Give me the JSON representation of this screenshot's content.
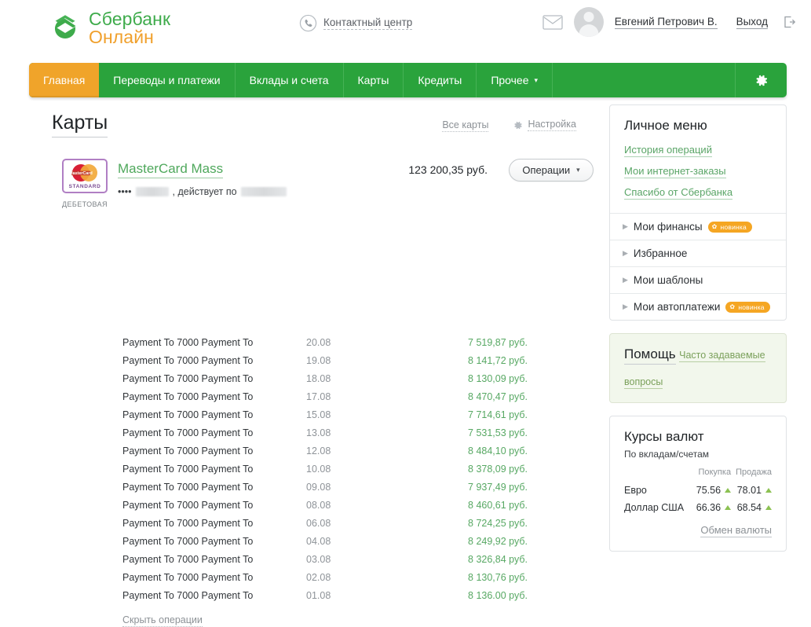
{
  "header": {
    "logo_line1": "Сбербанк",
    "logo_line2": "Онлайн",
    "contact_center": "Контактный центр",
    "user_name": "Евгений Петрович В.",
    "logout": "Выход"
  },
  "nav": {
    "items": [
      {
        "label": "Главная",
        "active": true,
        "caret": ""
      },
      {
        "label": "Переводы и платежи",
        "active": false,
        "caret": ""
      },
      {
        "label": "Вклады и счета",
        "active": false,
        "caret": ""
      },
      {
        "label": "Карты",
        "active": false,
        "caret": ""
      },
      {
        "label": "Кредиты",
        "active": false,
        "caret": ""
      },
      {
        "label": "Прочее",
        "active": false,
        "caret": "▾"
      }
    ]
  },
  "page": {
    "title": "Карты",
    "all_cards": "Все карты",
    "settings": "Настройка"
  },
  "card": {
    "brand_label": "STANDARD",
    "type_label": "ДЕБЕТОВАЯ",
    "name": "MasterCard Mass",
    "mask_prefix": "••••",
    "valid_text": ", действует по",
    "balance": "123 200,35 руб.",
    "operations_button": "Операции",
    "operations_caret": "▾"
  },
  "transactions": {
    "rows": [
      {
        "desc": "Payment To 7000 Payment To",
        "date": "20.08",
        "amount": "7 519,87 руб."
      },
      {
        "desc": "Payment To 7000 Payment To",
        "date": "19.08",
        "amount": "8 141,72 руб."
      },
      {
        "desc": "Payment To 7000 Payment To",
        "date": "18.08",
        "amount": "8 130,09 руб."
      },
      {
        "desc": "Payment To 7000 Payment To",
        "date": "17.08",
        "amount": "8 470,47 руб."
      },
      {
        "desc": "Payment To 7000 Payment To",
        "date": "15.08",
        "amount": "7 714,61 руб."
      },
      {
        "desc": "Payment To 7000 Payment To",
        "date": "13.08",
        "amount": "7 531,53 руб."
      },
      {
        "desc": "Payment To 7000 Payment To",
        "date": "12.08",
        "amount": "8 484,10 руб."
      },
      {
        "desc": "Payment To 7000 Payment To",
        "date": "10.08",
        "amount": "8 378,09 руб."
      },
      {
        "desc": "Payment To 7000 Payment To",
        "date": "09.08",
        "amount": "7 937,49 руб."
      },
      {
        "desc": "Payment To 7000 Payment To",
        "date": "08.08",
        "amount": "8 460,61 руб."
      },
      {
        "desc": "Payment To 7000 Payment To",
        "date": "06.08",
        "amount": "8 724,25 руб."
      },
      {
        "desc": "Payment To 7000 Payment To",
        "date": "04.08",
        "amount": "8 249,92 руб."
      },
      {
        "desc": "Payment To 7000 Payment To",
        "date": "03.08",
        "amount": "8 326,84 руб."
      },
      {
        "desc": "Payment To 7000 Payment To",
        "date": "02.08",
        "amount": "8 130,76 руб."
      },
      {
        "desc": "Payment To 7000 Payment To",
        "date": "01.08",
        "amount": "8 136.00 руб."
      }
    ],
    "hide_link": "Скрыть операции"
  },
  "personal_menu": {
    "title": "Личное меню",
    "links": [
      "История операций",
      "Мои интернет-заказы",
      "Спасибо от Сбербанка"
    ],
    "accordion": [
      {
        "label": "Мои финансы",
        "badge": "новинка"
      },
      {
        "label": "Избранное",
        "badge": ""
      },
      {
        "label": "Мои шаблоны",
        "badge": ""
      },
      {
        "label": "Мои автоплатежи",
        "badge": "новинка"
      }
    ]
  },
  "help": {
    "title": "Помощь",
    "link": "Часто задаваемые вопросы"
  },
  "fx": {
    "title": "Курсы валют",
    "subtitle": "По вкладам/счетам",
    "col_currency": "",
    "col_buy": "Покупка",
    "col_sell": "Продажа",
    "rows": [
      {
        "currency": "Евро",
        "buy": "75.56",
        "sell": "78.01",
        "buy_trend": "up",
        "sell_trend": "up"
      },
      {
        "currency": "Доллар США",
        "buy": "66.36",
        "sell": "68.54",
        "buy_trend": "up",
        "sell_trend": "up"
      }
    ],
    "exchange_link": "Обмен валюты"
  },
  "colors": {
    "green": "#2aa33c",
    "orange": "#f0a42a",
    "link_green": "#5aa567",
    "amount_green": "#57a863"
  }
}
